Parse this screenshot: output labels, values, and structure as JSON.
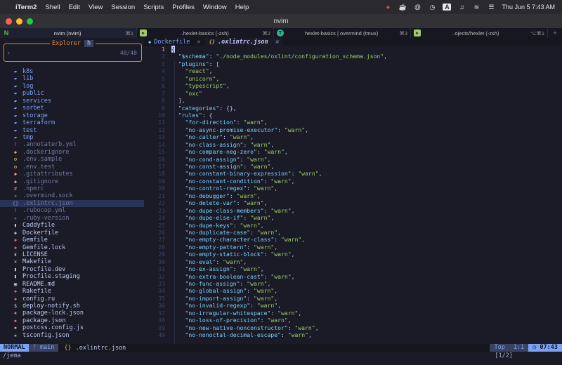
{
  "menubar": {
    "app": "iTerm2",
    "items": [
      "Shell",
      "Edit",
      "View",
      "Session",
      "Scripts",
      "Profiles",
      "Window",
      "Help"
    ],
    "clock": "Thu Jun 5  7:43 AM",
    "status_text": "A"
  },
  "window": {
    "title": "nvim"
  },
  "tabs": [
    {
      "title": "nvim (nvim)",
      "shortcut": "⌘1",
      "icon": "N",
      "color": "#5fb950"
    },
    {
      "title": "..hexlet-basics (-zsh)",
      "shortcut": "⌘2",
      "icon": "▸",
      "color": "#a3c76b"
    },
    {
      "title": "hexlet-basics | overmind (tmux)",
      "shortcut": "⌘3",
      "icon": "T",
      "color": "#2fb58e"
    },
    {
      "title": "..ojects/hexlet (-zsh)",
      "shortcut": "⌥⌘1",
      "icon": "▸",
      "color": "#a3c76b"
    }
  ],
  "explorer": {
    "title": "Explorer",
    "hint": "h",
    "prompt": "›",
    "count": "48/48"
  },
  "files": [
    {
      "name": "k8s",
      "type": "dir",
      "icon": "▰",
      "color": "#7aa2f7"
    },
    {
      "name": "lib",
      "type": "dir",
      "icon": "▰",
      "color": "#7aa2f7"
    },
    {
      "name": "log",
      "type": "dir",
      "icon": "▰",
      "color": "#7aa2f7"
    },
    {
      "name": "public",
      "type": "dir",
      "icon": "▰",
      "color": "#7aa2f7"
    },
    {
      "name": "services",
      "type": "dir",
      "icon": "▰",
      "color": "#7aa2f7"
    },
    {
      "name": "sorbet",
      "type": "dir",
      "icon": "▰",
      "color": "#7aa2f7"
    },
    {
      "name": "storage",
      "type": "dir",
      "icon": "▰",
      "color": "#7aa2f7"
    },
    {
      "name": "terraform",
      "type": "dir",
      "icon": "▰",
      "color": "#7aa2f7"
    },
    {
      "name": "test",
      "type": "dir",
      "icon": "▰",
      "color": "#7aa2f7"
    },
    {
      "name": "tmp",
      "type": "dir",
      "icon": "▰",
      "color": "#7aa2f7"
    },
    {
      "name": ".annotaterb.yml",
      "type": "dot",
      "icon": "!",
      "color": "#f7768e"
    },
    {
      "name": ".dockerignore",
      "type": "dot",
      "icon": "◆",
      "color": "#ff9e64"
    },
    {
      "name": ".env.sample",
      "type": "dot",
      "icon": "⚙",
      "color": "#e0af68"
    },
    {
      "name": ".env.test",
      "type": "dot",
      "icon": "⚙",
      "color": "#e0af68"
    },
    {
      "name": ".gitattributes",
      "type": "dot",
      "icon": "◆",
      "color": "#ff9e64"
    },
    {
      "name": ".gitignore",
      "type": "dot",
      "icon": "◆",
      "color": "#ff9e64"
    },
    {
      "name": ".npmrc",
      "type": "dot",
      "icon": "#",
      "color": "#f7768e"
    },
    {
      "name": ".overmind.sock",
      "type": "dot",
      "icon": "▪",
      "color": "#565f89"
    },
    {
      "name": ".oxlintrc.json",
      "type": "dot",
      "icon": "{}",
      "color": "#7aa2f7",
      "selected": true
    },
    {
      "name": ".rubocop.yml",
      "type": "dot",
      "icon": "!",
      "color": "#f7768e"
    },
    {
      "name": ".ruby-version",
      "type": "dot",
      "icon": "▪",
      "color": "#565f89"
    },
    {
      "name": "Caddyfile",
      "type": "file",
      "icon": "▮",
      "color": "#c0caf5"
    },
    {
      "name": "Dockerfile",
      "type": "file",
      "icon": "◆",
      "color": "#7dcfff"
    },
    {
      "name": "Gemfile",
      "type": "file",
      "icon": "◈",
      "color": "#f7768e"
    },
    {
      "name": "Gemfile.lock",
      "type": "file",
      "icon": "◈",
      "color": "#f7768e"
    },
    {
      "name": "LICENSE",
      "type": "file",
      "icon": "♜",
      "color": "#e0af68"
    },
    {
      "name": "Makefile",
      "type": "file",
      "icon": "✕",
      "color": "#c0caf5"
    },
    {
      "name": "Procfile.dev",
      "type": "file",
      "icon": "▮",
      "color": "#c0caf5"
    },
    {
      "name": "Procfile.staging",
      "type": "file",
      "icon": "▮",
      "color": "#c0caf5"
    },
    {
      "name": "README.md",
      "type": "file",
      "icon": "▣",
      "color": "#c0caf5"
    },
    {
      "name": "Rakefile",
      "type": "file",
      "icon": "◈",
      "color": "#f7768e"
    },
    {
      "name": "config.ru",
      "type": "file",
      "icon": "◈",
      "color": "#f7768e"
    },
    {
      "name": "deploy-notify.sh",
      "type": "file",
      "icon": "$",
      "color": "#c0caf5"
    },
    {
      "name": "package-lock.json",
      "type": "file",
      "icon": "▪",
      "color": "#f7768e"
    },
    {
      "name": "package.json",
      "type": "file",
      "icon": "▪",
      "color": "#f7768e"
    },
    {
      "name": "postcss.config.js",
      "type": "file",
      "icon": "▪",
      "color": "#e0af68"
    },
    {
      "name": "tsconfig.json",
      "type": "file",
      "icon": "▪",
      "color": "#7aa2f7"
    }
  ],
  "editor_tabs": [
    {
      "icon": "◆",
      "label": "Dockerfile",
      "close": "✕",
      "active": false
    },
    {
      "icon": "{}",
      "label": ".oxlintrc.json",
      "close": "✕",
      "active": true
    }
  ],
  "code": [
    [
      {
        "t": "{",
        "c": "cur"
      }
    ],
    [
      {
        "t": "  "
      },
      {
        "t": "\"$schema\"",
        "c": "k"
      },
      {
        "t": ": "
      },
      {
        "t": "\"./node_modules/oxlint/configuration_schema.json\"",
        "c": "s"
      },
      {
        "t": ","
      }
    ],
    [
      {
        "t": "  "
      },
      {
        "t": "\"plugins\"",
        "c": "k"
      },
      {
        "t": ": ["
      }
    ],
    [
      {
        "t": "    "
      },
      {
        "t": "\"react\"",
        "c": "s"
      },
      {
        "t": ","
      }
    ],
    [
      {
        "t": "    "
      },
      {
        "t": "\"unicorn\"",
        "c": "s"
      },
      {
        "t": ","
      }
    ],
    [
      {
        "t": "    "
      },
      {
        "t": "\"typescript\"",
        "c": "s"
      },
      {
        "t": ","
      }
    ],
    [
      {
        "t": "    "
      },
      {
        "t": "\"oxc\"",
        "c": "s"
      }
    ],
    [
      {
        "t": "  ],"
      }
    ],
    [
      {
        "t": "  "
      },
      {
        "t": "\"categories\"",
        "c": "k"
      },
      {
        "t": ": {},"
      }
    ],
    [
      {
        "t": "  "
      },
      {
        "t": "\"rules\"",
        "c": "k"
      },
      {
        "t": ": {"
      }
    ],
    [
      {
        "t": "    "
      },
      {
        "t": "\"for-direction\"",
        "c": "k"
      },
      {
        "t": ": "
      },
      {
        "t": "\"warn\"",
        "c": "s"
      },
      {
        "t": ","
      }
    ],
    [
      {
        "t": "    "
      },
      {
        "t": "\"no-async-promise-executor\"",
        "c": "k"
      },
      {
        "t": ": "
      },
      {
        "t": "\"warn\"",
        "c": "s"
      },
      {
        "t": ","
      }
    ],
    [
      {
        "t": "    "
      },
      {
        "t": "\"no-caller\"",
        "c": "k"
      },
      {
        "t": ": "
      },
      {
        "t": "\"warn\"",
        "c": "s"
      },
      {
        "t": ","
      }
    ],
    [
      {
        "t": "    "
      },
      {
        "t": "\"no-class-assign\"",
        "c": "k"
      },
      {
        "t": ": "
      },
      {
        "t": "\"warn\"",
        "c": "s"
      },
      {
        "t": ","
      }
    ],
    [
      {
        "t": "    "
      },
      {
        "t": "\"no-compare-neg-zero\"",
        "c": "k"
      },
      {
        "t": ": "
      },
      {
        "t": "\"warn\"",
        "c": "s"
      },
      {
        "t": ","
      }
    ],
    [
      {
        "t": "    "
      },
      {
        "t": "\"no-cond-assign\"",
        "c": "k"
      },
      {
        "t": ": "
      },
      {
        "t": "\"warn\"",
        "c": "s"
      },
      {
        "t": ","
      }
    ],
    [
      {
        "t": "    "
      },
      {
        "t": "\"no-const-assign\"",
        "c": "k"
      },
      {
        "t": ": "
      },
      {
        "t": "\"warn\"",
        "c": "s"
      },
      {
        "t": ","
      }
    ],
    [
      {
        "t": "    "
      },
      {
        "t": "\"no-constant-binary-expression\"",
        "c": "k"
      },
      {
        "t": ": "
      },
      {
        "t": "\"warn\"",
        "c": "s"
      },
      {
        "t": ","
      }
    ],
    [
      {
        "t": "    "
      },
      {
        "t": "\"no-constant-condition\"",
        "c": "k"
      },
      {
        "t": ": "
      },
      {
        "t": "\"warn\"",
        "c": "s"
      },
      {
        "t": ","
      }
    ],
    [
      {
        "t": "    "
      },
      {
        "t": "\"no-control-regex\"",
        "c": "k"
      },
      {
        "t": ": "
      },
      {
        "t": "\"warn\"",
        "c": "s"
      },
      {
        "t": ","
      }
    ],
    [
      {
        "t": "    "
      },
      {
        "t": "\"no-debugger\"",
        "c": "k"
      },
      {
        "t": ": "
      },
      {
        "t": "\"warn\"",
        "c": "s"
      },
      {
        "t": ","
      }
    ],
    [
      {
        "t": "    "
      },
      {
        "t": "\"no-delete-var\"",
        "c": "k"
      },
      {
        "t": ": "
      },
      {
        "t": "\"warn\"",
        "c": "s"
      },
      {
        "t": ","
      }
    ],
    [
      {
        "t": "    "
      },
      {
        "t": "\"no-dupe-class-members\"",
        "c": "k"
      },
      {
        "t": ": "
      },
      {
        "t": "\"warn\"",
        "c": "s"
      },
      {
        "t": ","
      }
    ],
    [
      {
        "t": "    "
      },
      {
        "t": "\"no-dupe-else-if\"",
        "c": "k"
      },
      {
        "t": ": "
      },
      {
        "t": "\"warn\"",
        "c": "s"
      },
      {
        "t": ","
      }
    ],
    [
      {
        "t": "    "
      },
      {
        "t": "\"no-dupe-keys\"",
        "c": "k"
      },
      {
        "t": ": "
      },
      {
        "t": "\"warn\"",
        "c": "s"
      },
      {
        "t": ","
      }
    ],
    [
      {
        "t": "    "
      },
      {
        "t": "\"no-duplicate-case\"",
        "c": "k"
      },
      {
        "t": ": "
      },
      {
        "t": "\"warn\"",
        "c": "s"
      },
      {
        "t": ","
      }
    ],
    [
      {
        "t": "    "
      },
      {
        "t": "\"no-empty-character-class\"",
        "c": "k"
      },
      {
        "t": ": "
      },
      {
        "t": "\"warn\"",
        "c": "s"
      },
      {
        "t": ","
      }
    ],
    [
      {
        "t": "    "
      },
      {
        "t": "\"no-empty-pattern\"",
        "c": "k"
      },
      {
        "t": ": "
      },
      {
        "t": "\"warn\"",
        "c": "s"
      },
      {
        "t": ","
      }
    ],
    [
      {
        "t": "    "
      },
      {
        "t": "\"no-empty-static-block\"",
        "c": "k"
      },
      {
        "t": ": "
      },
      {
        "t": "\"warn\"",
        "c": "s"
      },
      {
        "t": ","
      }
    ],
    [
      {
        "t": "    "
      },
      {
        "t": "\"no-eval\"",
        "c": "k"
      },
      {
        "t": ": "
      },
      {
        "t": "\"warn\"",
        "c": "s"
      },
      {
        "t": ","
      }
    ],
    [
      {
        "t": "    "
      },
      {
        "t": "\"no-ex-assign\"",
        "c": "k"
      },
      {
        "t": ": "
      },
      {
        "t": "\"warn\"",
        "c": "s"
      },
      {
        "t": ","
      }
    ],
    [
      {
        "t": "    "
      },
      {
        "t": "\"no-extra-boolean-cast\"",
        "c": "k"
      },
      {
        "t": ": "
      },
      {
        "t": "\"warn\"",
        "c": "s"
      },
      {
        "t": ","
      }
    ],
    [
      {
        "t": "    "
      },
      {
        "t": "\"no-func-assign\"",
        "c": "k"
      },
      {
        "t": ": "
      },
      {
        "t": "\"warn\"",
        "c": "s"
      },
      {
        "t": ","
      }
    ],
    [
      {
        "t": "    "
      },
      {
        "t": "\"no-global-assign\"",
        "c": "k"
      },
      {
        "t": ": "
      },
      {
        "t": "\"warn\"",
        "c": "s"
      },
      {
        "t": ","
      }
    ],
    [
      {
        "t": "    "
      },
      {
        "t": "\"no-import-assign\"",
        "c": "k"
      },
      {
        "t": ": "
      },
      {
        "t": "\"warn\"",
        "c": "s"
      },
      {
        "t": ","
      }
    ],
    [
      {
        "t": "    "
      },
      {
        "t": "\"no-invalid-regexp\"",
        "c": "k"
      },
      {
        "t": ": "
      },
      {
        "t": "\"warn\"",
        "c": "s"
      },
      {
        "t": ","
      }
    ],
    [
      {
        "t": "    "
      },
      {
        "t": "\"no-irregular-whitespace\"",
        "c": "k"
      },
      {
        "t": ": "
      },
      {
        "t": "\"warn\"",
        "c": "s"
      },
      {
        "t": ","
      }
    ],
    [
      {
        "t": "    "
      },
      {
        "t": "\"no-loss-of-precision\"",
        "c": "k"
      },
      {
        "t": ": "
      },
      {
        "t": "\"warn\"",
        "c": "s"
      },
      {
        "t": ","
      }
    ],
    [
      {
        "t": "    "
      },
      {
        "t": "\"no-new-native-nonconstructor\"",
        "c": "k"
      },
      {
        "t": ": "
      },
      {
        "t": "\"warn\"",
        "c": "s"
      },
      {
        "t": ","
      }
    ],
    [
      {
        "t": "    "
      },
      {
        "t": "\"no-nonoctal-decimal-escape\"",
        "c": "k"
      },
      {
        "t": ": "
      },
      {
        "t": "\"warn\"",
        "c": "s"
      },
      {
        "t": ","
      }
    ]
  ],
  "status": {
    "mode": "NORMAL",
    "branch": "ᚠ main",
    "file_icon": "{}",
    "file": ".oxlintrc.json",
    "position": "Top",
    "location": "1:1",
    "time": "◷ 07:43"
  },
  "cmdline": {
    "text": "/jema",
    "search_count": "[1/2]"
  }
}
